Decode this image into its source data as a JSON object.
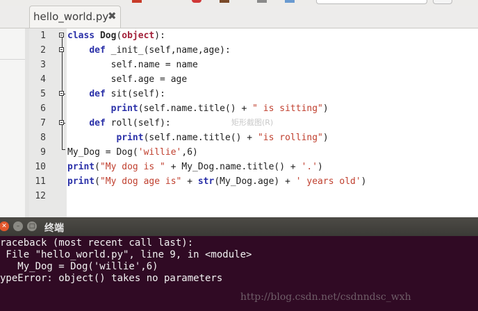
{
  "editor": {
    "tab": {
      "filename": "hello_world.py",
      "close_glyph": "✖"
    },
    "line_numbers": [
      "1",
      "2",
      "3",
      "4",
      "5",
      "6",
      "7",
      "8",
      "9",
      "10",
      "11",
      "12"
    ],
    "code": {
      "l1": {
        "t1": "class",
        "t2": " ",
        "t3": "Dog",
        "t4": "(",
        "t5": "object",
        "t6": "):"
      },
      "l2": {
        "t1": "    ",
        "t2": "def",
        "t3": " _init_(self,name,age):"
      },
      "l3": {
        "t1": "        self.name = name"
      },
      "l4": {
        "t1": "        self.age = age"
      },
      "l5": {
        "t1": "    ",
        "t2": "def",
        "t3": " sit(self):"
      },
      "l6": {
        "t1": "        ",
        "t2": "print",
        "t3": "(self.name.title() + ",
        "t4": "\" is sitting\"",
        "t5": ")"
      },
      "l7": {
        "t1": "    ",
        "t2": "def",
        "t3": " roll(self):"
      },
      "l8": {
        "t1": "         ",
        "t2": "print",
        "t3": "(self.name.title() + ",
        "t4": "\"is rolling\"",
        "t5": ")"
      },
      "l9": {
        "t1": "My_Dog = Dog(",
        "t2": "'willie'",
        "t3": ",6)"
      },
      "l10": {
        "t1": "print",
        "t2": "(",
        "t3": "\"My dog is \"",
        "t4": " + My_Dog.name.title() + ",
        "t5": "'.'",
        "t6": ")"
      },
      "l11": {
        "t1": "print",
        "t2": "(",
        "t3": "\"My dog age is\"",
        "t4": " + ",
        "t5": "str",
        "t6": "(My_Dog.age) + ",
        "t7": "' years old'",
        "t8": ")"
      }
    },
    "overlay_hint": "矩形截图(R)"
  },
  "terminal": {
    "title": "终端",
    "lines": [
      "raceback (most recent call last):",
      " File \"hello_world.py\", line 9, in <module>",
      "   My_Dog = Dog('willie',6)",
      "ypeError: object() takes no parameters"
    ]
  },
  "watermark": "http://blog.csdn.net/csdnndsc_wxh",
  "colors": {
    "terminal_bg": "#300a24",
    "keyword": "#2a30a8",
    "string": "#c0402f",
    "close_button": "#e2572c"
  },
  "icons": [
    "close-icon",
    "minimize-icon",
    "maximize-icon",
    "fold-marker-icon"
  ]
}
